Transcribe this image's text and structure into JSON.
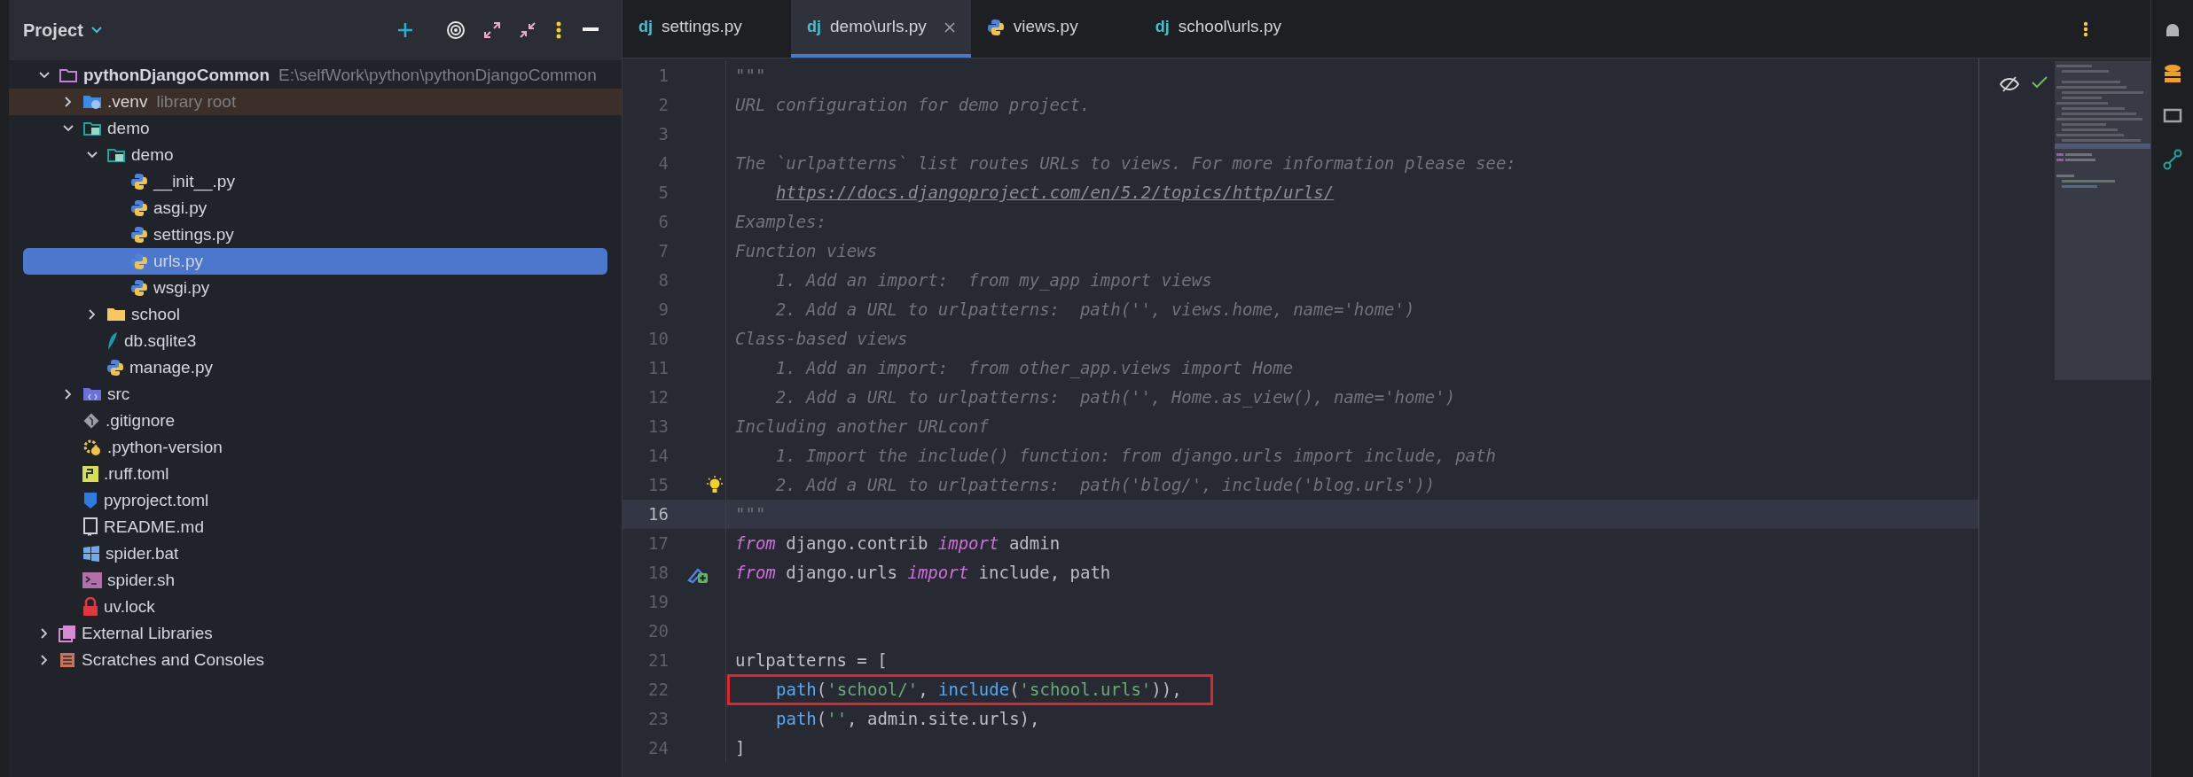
{
  "project_panel": {
    "title": "Project",
    "tree": [
      {
        "name": "pythonDjangoCommon",
        "kind": "root",
        "hint": "E:\\selfWork\\python\\pythonDjangoCommon",
        "expanded": true,
        "selected": false,
        "children": [
          {
            "name": ".venv",
            "kind": "venv",
            "hint": "library root",
            "expanded": false,
            "selected": false
          },
          {
            "name": "demo",
            "kind": "module",
            "expanded": true,
            "selected": false,
            "children": [
              {
                "name": "demo",
                "kind": "module",
                "expanded": true,
                "selected": false,
                "children": [
                  {
                    "name": "__init__.py",
                    "kind": "python",
                    "selected": false
                  },
                  {
                    "name": "asgi.py",
                    "kind": "python",
                    "selected": false
                  },
                  {
                    "name": "settings.py",
                    "kind": "python",
                    "selected": false
                  },
                  {
                    "name": "urls.py",
                    "kind": "python",
                    "selected": true
                  },
                  {
                    "name": "wsgi.py",
                    "kind": "python",
                    "selected": false
                  }
                ]
              },
              {
                "name": "school",
                "kind": "folder",
                "expanded": false,
                "selected": false
              },
              {
                "name": "db.sqlite3",
                "kind": "sqlite",
                "selected": false
              },
              {
                "name": "manage.py",
                "kind": "python",
                "selected": false
              }
            ]
          },
          {
            "name": "src",
            "kind": "src",
            "expanded": false,
            "selected": false
          },
          {
            "name": ".gitignore",
            "kind": "git",
            "selected": false
          },
          {
            "name": ".python-version",
            "kind": "pyversion",
            "selected": false
          },
          {
            "name": ".ruff.toml",
            "kind": "ruff",
            "selected": false
          },
          {
            "name": "pyproject.toml",
            "kind": "toml",
            "selected": false
          },
          {
            "name": "README.md",
            "kind": "readme",
            "selected": false
          },
          {
            "name": "spider.bat",
            "kind": "bat",
            "selected": false
          },
          {
            "name": "spider.sh",
            "kind": "sh",
            "selected": false
          },
          {
            "name": "uv.lock",
            "kind": "lock",
            "selected": false
          }
        ]
      },
      {
        "name": "External Libraries",
        "kind": "libraries",
        "expanded": false,
        "selected": false
      },
      {
        "name": "Scratches and Consoles",
        "kind": "scratches",
        "expanded": false,
        "selected": false
      }
    ]
  },
  "editor_tabs": [
    {
      "label": "settings.py",
      "kind": "django",
      "badge": "dj",
      "selected": false,
      "closable": false
    },
    {
      "label": "demo\\urls.py",
      "kind": "django",
      "badge": "dj",
      "selected": true,
      "closable": true
    },
    {
      "label": "views.py",
      "kind": "python",
      "selected": false,
      "closable": false
    },
    {
      "label": "school\\urls.py",
      "kind": "django",
      "badge": "dj",
      "selected": false,
      "closable": false
    }
  ],
  "code_lines": [
    {
      "number": "1",
      "current": false,
      "boxed": false,
      "tokens": [
        {
          "kind": "doc",
          "text": "\"\"\""
        }
      ]
    },
    {
      "number": "2",
      "current": false,
      "boxed": false,
      "tokens": [
        {
          "kind": "doc",
          "text": "URL configuration for demo project."
        }
      ]
    },
    {
      "number": "3",
      "current": false,
      "boxed": false
    },
    {
      "number": "4",
      "current": false,
      "boxed": false,
      "tokens": [
        {
          "kind": "doc",
          "text": "The `urlpatterns` list routes URLs to views. For more information please see:"
        }
      ]
    },
    {
      "number": "5",
      "current": false,
      "boxed": false,
      "indented": true,
      "tokens": [
        {
          "kind": "link",
          "text": "https://docs.djangoproject.com/en/5.2/topics/http/urls/"
        }
      ]
    },
    {
      "number": "6",
      "current": false,
      "boxed": false,
      "tokens": [
        {
          "kind": "doc",
          "text": "Examples:"
        }
      ]
    },
    {
      "number": "7",
      "current": false,
      "boxed": false,
      "tokens": [
        {
          "kind": "doc",
          "text": "Function views"
        }
      ]
    },
    {
      "number": "8",
      "current": false,
      "boxed": false,
      "tokens": [
        {
          "kind": "doc",
          "text": "    1. Add an import:  from my_app import views"
        }
      ]
    },
    {
      "number": "9",
      "current": false,
      "boxed": false,
      "tokens": [
        {
          "kind": "doc",
          "text": "    2. Add a URL to urlpatterns:  path('', views.home, name='home')"
        }
      ]
    },
    {
      "number": "10",
      "current": false,
      "boxed": false,
      "tokens": [
        {
          "kind": "doc",
          "text": "Class-based views"
        }
      ]
    },
    {
      "number": "11",
      "current": false,
      "boxed": false,
      "tokens": [
        {
          "kind": "doc",
          "text": "    1. Add an import:  from other_app.views import Home"
        }
      ]
    },
    {
      "number": "12",
      "current": false,
      "boxed": false,
      "tokens": [
        {
          "kind": "doc",
          "text": "    2. Add a URL to urlpatterns:  path('', Home.as_view(), name='home')"
        }
      ]
    },
    {
      "number": "13",
      "current": false,
      "boxed": false,
      "tokens": [
        {
          "kind": "doc",
          "text": "Including another URLconf"
        }
      ]
    },
    {
      "number": "14",
      "current": false,
      "boxed": false,
      "tokens": [
        {
          "kind": "doc",
          "text": "    1. Import the include() function: from django.urls import include, path"
        }
      ]
    },
    {
      "number": "15",
      "current": false,
      "boxed": false,
      "gutter": {
        "kind": "bulb"
      },
      "tokens": [
        {
          "kind": "doc",
          "text": "    2. Add a URL to urlpatterns:  path('blog/', include('blog.urls'))"
        }
      ]
    },
    {
      "number": "16",
      "current": true,
      "boxed": false,
      "tokens": [
        {
          "kind": "doc",
          "text": "\"\"\""
        }
      ]
    },
    {
      "number": "17",
      "current": false,
      "boxed": false,
      "tokens": [
        {
          "kind": "keyword",
          "text": "from"
        },
        {
          "kind": "plain",
          "text": " django.contrib "
        },
        {
          "kind": "keyword",
          "text": "import"
        },
        {
          "kind": "plain",
          "text": " admin"
        }
      ]
    },
    {
      "number": "18",
      "current": false,
      "boxed": false,
      "gutter": {
        "kind": "import"
      },
      "tokens": [
        {
          "kind": "keyword",
          "text": "from"
        },
        {
          "kind": "plain",
          "text": " django.urls "
        },
        {
          "kind": "keyword",
          "text": "import"
        },
        {
          "kind": "plain",
          "text": " include, path"
        }
      ]
    },
    {
      "number": "19",
      "current": false,
      "boxed": false
    },
    {
      "number": "20",
      "current": false,
      "boxed": false
    },
    {
      "number": "21",
      "current": false,
      "boxed": false,
      "tokens": [
        {
          "kind": "plain",
          "text": "urlpatterns = ["
        }
      ]
    },
    {
      "number": "22",
      "current": false,
      "boxed": true,
      "indented": true,
      "tokens": [
        {
          "kind": "func",
          "text": "path"
        },
        {
          "kind": "plain",
          "text": "("
        },
        {
          "kind": "string",
          "text": "'school/'"
        },
        {
          "kind": "plain",
          "text": ", "
        },
        {
          "kind": "func",
          "text": "include"
        },
        {
          "kind": "plain",
          "text": "("
        },
        {
          "kind": "string",
          "text": "'school.urls'"
        },
        {
          "kind": "plain",
          "text": ")),"
        }
      ]
    },
    {
      "number": "23",
      "current": false,
      "boxed": false,
      "indented": true,
      "tokens": [
        {
          "kind": "func",
          "text": "path"
        },
        {
          "kind": "plain",
          "text": "("
        },
        {
          "kind": "string",
          "text": "''"
        },
        {
          "kind": "plain",
          "text": ", admin.site.urls),"
        }
      ]
    },
    {
      "number": "24",
      "current": false,
      "boxed": false,
      "tokens": [
        {
          "kind": "plain",
          "text": "]"
        }
      ]
    }
  ]
}
